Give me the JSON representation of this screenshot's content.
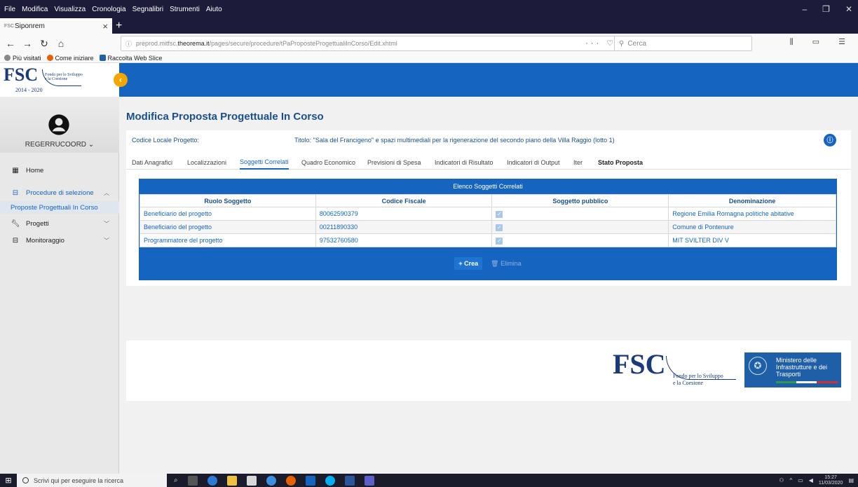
{
  "browser": {
    "menu": [
      "File",
      "Modifica",
      "Visualizza",
      "Cronologia",
      "Segnalibri",
      "Strumenti",
      "Aiuto"
    ],
    "tab_title": "Siponrem",
    "tab_favicon": "FSC",
    "url_prefix": "preprod.mitfsc.",
    "url_host": "theorema.it",
    "url_path": "/pages/secure/procedure/tPaProposteProgettualiInCorso/Edit.xhtml",
    "search_placeholder": "Cerca",
    "bookmarks": [
      "Più visitati",
      "Come iniziare",
      "Raccolta Web Slice"
    ]
  },
  "logo": {
    "text": "FSC",
    "subtitle_line1": "Fondo per lo Sviluppo",
    "subtitle_line2": "e la Coesione",
    "years": "2014 - 2020"
  },
  "user": {
    "name": "REGERRUCOORD"
  },
  "sidebar": {
    "home": "Home",
    "procedure": "Procedure di selezione",
    "procedure_sub": "Proposte Progettuali In Corso",
    "progetti": "Progetti",
    "monitoraggio": "Monitoraggio"
  },
  "page": {
    "title": "Modifica Proposta Progettuale In Corso",
    "codice_label": "Codice Locale Progetto:",
    "titolo": "Titolo: \"Sala del Francigeno\" e spazi multimediali per la rigenerazione del secondo piano della Villa Raggio (lotto 1)",
    "tabs": [
      "Dati Anagrafici",
      "Localizzazioni",
      "Soggetti Correlati",
      "Quadro Economico",
      "Previsioni di Spesa",
      "Indicatori di Risultato",
      "Indicatori di Output",
      "Iter",
      "Stato Proposta"
    ],
    "table_title": "Elenco Soggetti Correlati",
    "columns": [
      "Ruolo Soggetto",
      "Codice Fiscale",
      "Soggetto pubblico",
      "Denominazione"
    ],
    "rows": [
      {
        "ruolo": "Beneficiario del progetto",
        "codice": "80062590379",
        "pubblico": true,
        "denominazione": "Regione Emilia Romagna politiche abitative"
      },
      {
        "ruolo": "Beneficiario del progetto",
        "codice": "00211890330",
        "pubblico": true,
        "denominazione": "Comune di Pontenure"
      },
      {
        "ruolo": "Programmatore del progetto",
        "codice": "97532760580",
        "pubblico": true,
        "denominazione": "MIT SVILTER DIV V"
      }
    ],
    "btn_crea": "+ Crea",
    "btn_elimina": "Elimina"
  },
  "footer": {
    "fsc": "FSC",
    "fsc_sub1": "Fondo per lo Sviluppo",
    "fsc_sub2": "e la Coesione",
    "mit1": "Ministero delle",
    "mit2": "Infrastrutture e dei",
    "mit3": "Trasporti"
  },
  "taskbar": {
    "search": "Scrivi qui per eseguire la ricerca",
    "time": "15:27",
    "date": "11/03/2020"
  },
  "colors": {
    "primary": "#1565c0",
    "accent": "#f3a600",
    "dark_chrome": "#1c1b3a"
  }
}
